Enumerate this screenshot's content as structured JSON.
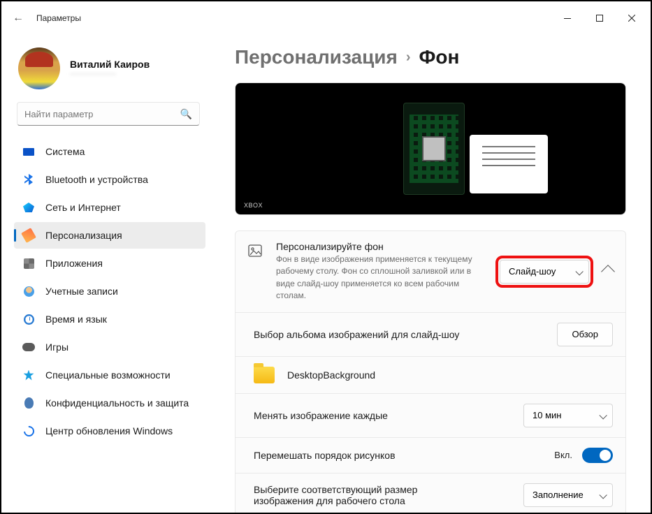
{
  "window": {
    "title": "Параметры"
  },
  "profile": {
    "name": "Виталий Каиров",
    "email": "——————"
  },
  "search": {
    "placeholder": "Найти параметр"
  },
  "nav": [
    {
      "label": "Система"
    },
    {
      "label": "Bluetooth и устройства"
    },
    {
      "label": "Сеть и Интернет"
    },
    {
      "label": "Персонализация"
    },
    {
      "label": "Приложения"
    },
    {
      "label": "Учетные записи"
    },
    {
      "label": "Время и язык"
    },
    {
      "label": "Игры"
    },
    {
      "label": "Специальные возможности"
    },
    {
      "label": "Конфиденциальность и защита"
    },
    {
      "label": "Центр обновления Windows"
    }
  ],
  "breadcrumb": {
    "parent": "Персонализация",
    "current": "Фон"
  },
  "rows": {
    "personalize": {
      "title": "Персонализируйте фон",
      "desc": "Фон в виде изображения применяется к текущему рабочему столу. Фон со сплошной заливкой или в виде слайд-шоу применяется ко всем рабочим столам.",
      "dropdown": "Слайд-шоу"
    },
    "album": {
      "title": "Выбор альбома изображений для слайд-шоу",
      "button": "Обзор"
    },
    "folder": {
      "name": "DesktopBackground"
    },
    "interval": {
      "title": "Менять изображение каждые",
      "dropdown": "10 мин"
    },
    "shuffle": {
      "title": "Перемешать порядок рисунков",
      "state": "Вкл."
    },
    "fit": {
      "title": "Выберите соответствующий размер изображения для рабочего стола",
      "dropdown": "Заполнение"
    }
  }
}
